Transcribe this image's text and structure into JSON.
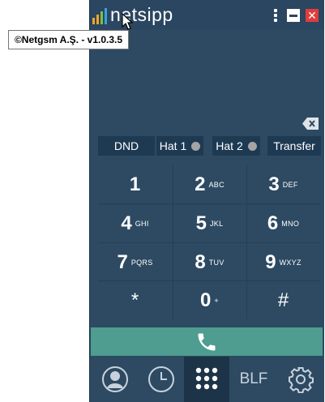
{
  "app": {
    "brand": "netsipp",
    "tooltip": "©Netgsm A.Ş. - v1.0.3.5",
    "colors": {
      "background": "#2d4a62",
      "titlebar": "#2a4660",
      "button": "#1d3a52",
      "call": "#4e9d90",
      "close": "#e03c3c",
      "logo_bars": [
        "#f5a623",
        "#f5a623",
        "#7ac143",
        "#3ea0dc"
      ]
    }
  },
  "titlebar": {
    "menu_icon": "kebab-menu-icon",
    "minimize_icon": "minimize-icon",
    "close_icon": "close-icon",
    "close_glyph": "✕"
  },
  "options": {
    "dnd": "DND",
    "hat1": "Hat 1",
    "hat2": "Hat 2",
    "transfer": "Transfer"
  },
  "keypad": [
    {
      "digit": "1",
      "sub": ""
    },
    {
      "digit": "2",
      "sub": "ABC"
    },
    {
      "digit": "3",
      "sub": "DEF"
    },
    {
      "digit": "4",
      "sub": "GHI"
    },
    {
      "digit": "5",
      "sub": "JKL"
    },
    {
      "digit": "6",
      "sub": "MNO"
    },
    {
      "digit": "7",
      "sub": "PQRS"
    },
    {
      "digit": "8",
      "sub": "TUV"
    },
    {
      "digit": "9",
      "sub": "WXYZ"
    },
    {
      "digit": "*",
      "sub": ""
    },
    {
      "digit": "0",
      "sub": "+"
    },
    {
      "digit": "#",
      "sub": ""
    }
  ],
  "bottom_nav": {
    "contacts_icon": "contacts-icon",
    "history_icon": "clock-icon",
    "dialpad_icon": "dialpad-icon",
    "blf": "BLF",
    "settings_icon": "gear-icon"
  }
}
